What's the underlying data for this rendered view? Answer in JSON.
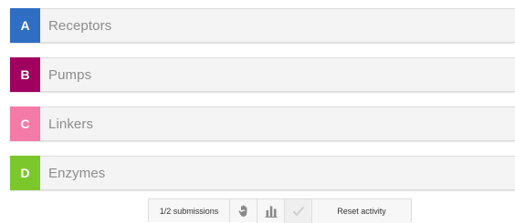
{
  "options": [
    {
      "letter": "A",
      "label": "Receptors",
      "color": "#2f6ec2"
    },
    {
      "letter": "B",
      "label": "Pumps",
      "color": "#a00060"
    },
    {
      "letter": "C",
      "label": "Linkers",
      "color": "#f47aa7"
    },
    {
      "letter": "D",
      "label": "Enzymes",
      "color": "#7cc72c"
    }
  ],
  "toolbar": {
    "submissions_text": "1/2 submissions",
    "reset_label": "Reset activity",
    "icons": [
      "hand-icon",
      "bar-chart-icon",
      "checkmark-icon"
    ]
  },
  "colors": {
    "icon_gray": "#8a8a8a",
    "check_disabled": "#cfcfcf"
  }
}
